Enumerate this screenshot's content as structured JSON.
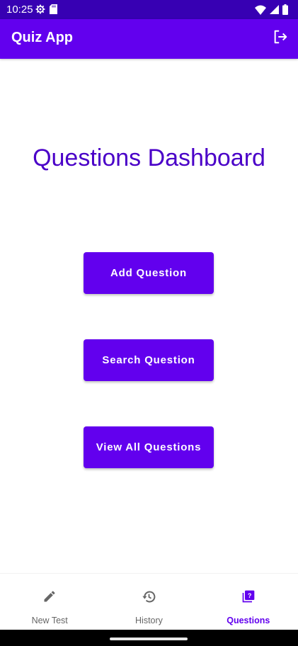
{
  "status_bar": {
    "time": "10:25"
  },
  "app_bar": {
    "title": "Quiz App",
    "logout_icon": "logout-icon"
  },
  "main": {
    "heading": "Questions Dashboard",
    "buttons": [
      {
        "label": "Add Question"
      },
      {
        "label": "Search Question"
      },
      {
        "label": "View All Questions"
      }
    ]
  },
  "bottom_nav": {
    "items": [
      {
        "label": "New Test",
        "icon": "pencil-icon",
        "active": false
      },
      {
        "label": "History",
        "icon": "history-icon",
        "active": false
      },
      {
        "label": "Questions",
        "icon": "quiz-icon",
        "active": true
      }
    ]
  },
  "colors": {
    "status_bar": "#3700b3",
    "primary": "#6200ee",
    "heading": "#4a00c8",
    "inactive_nav": "#666666"
  }
}
